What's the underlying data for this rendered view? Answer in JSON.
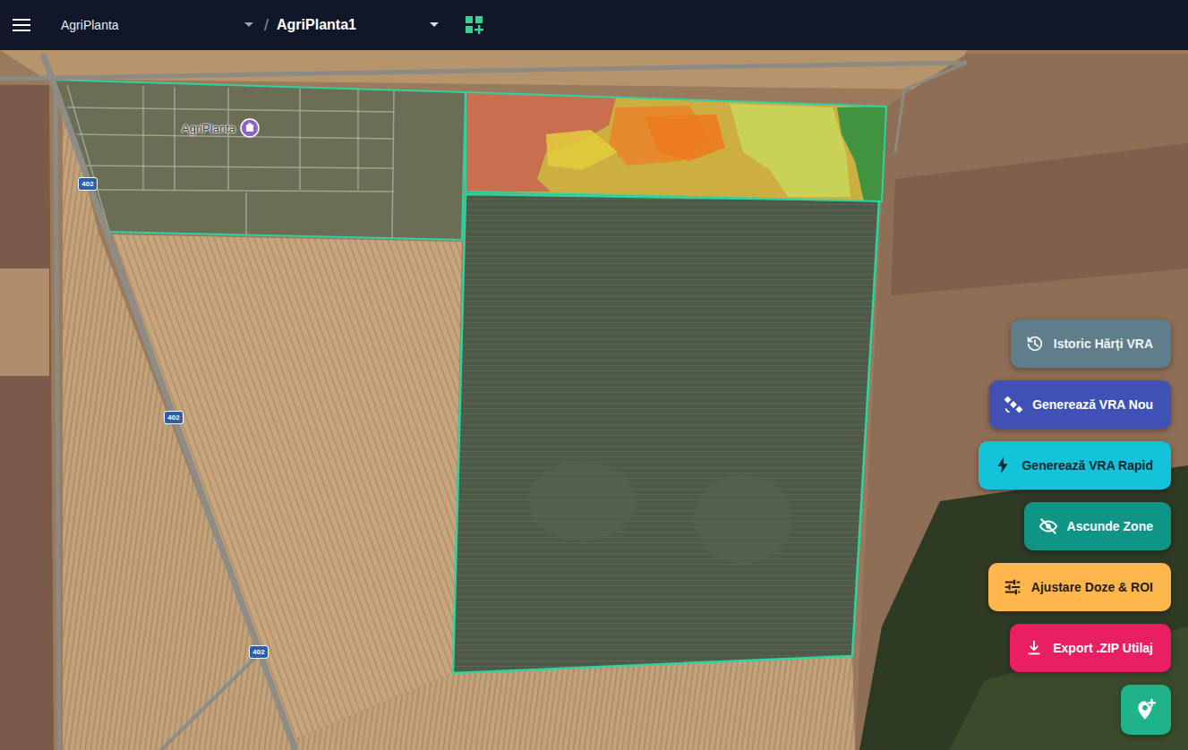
{
  "header": {
    "project": "AgriPlanta",
    "separator": "/",
    "field": "AgriPlanta1"
  },
  "map": {
    "place_label": "AgriPlanta",
    "road_shields": [
      "402",
      "402",
      "402"
    ],
    "zones": [
      {
        "color": "#d4b53e"
      },
      {
        "color": "#c8674e"
      },
      {
        "color": "#e8852a"
      },
      {
        "color": "#ee7a1c"
      },
      {
        "color": "#c9d65a"
      },
      {
        "color": "#2f8f3f"
      },
      {
        "color": "#e0cc3a"
      }
    ]
  },
  "buttons": [
    {
      "label": "Istoric Hărți VRA",
      "color": "#607d8b"
    },
    {
      "label": "Generează VRA Nou",
      "color": "#3f51b5"
    },
    {
      "label": "Generează VRA Rapid",
      "color": "#14c2d9"
    },
    {
      "label": "Ascunde Zone",
      "color": "#0e9585"
    },
    {
      "label": "Ajustare Doze & ROI",
      "color": "#ffb74d"
    },
    {
      "label": "Export .ZIP Utilaj",
      "color": "#e91e63"
    }
  ]
}
